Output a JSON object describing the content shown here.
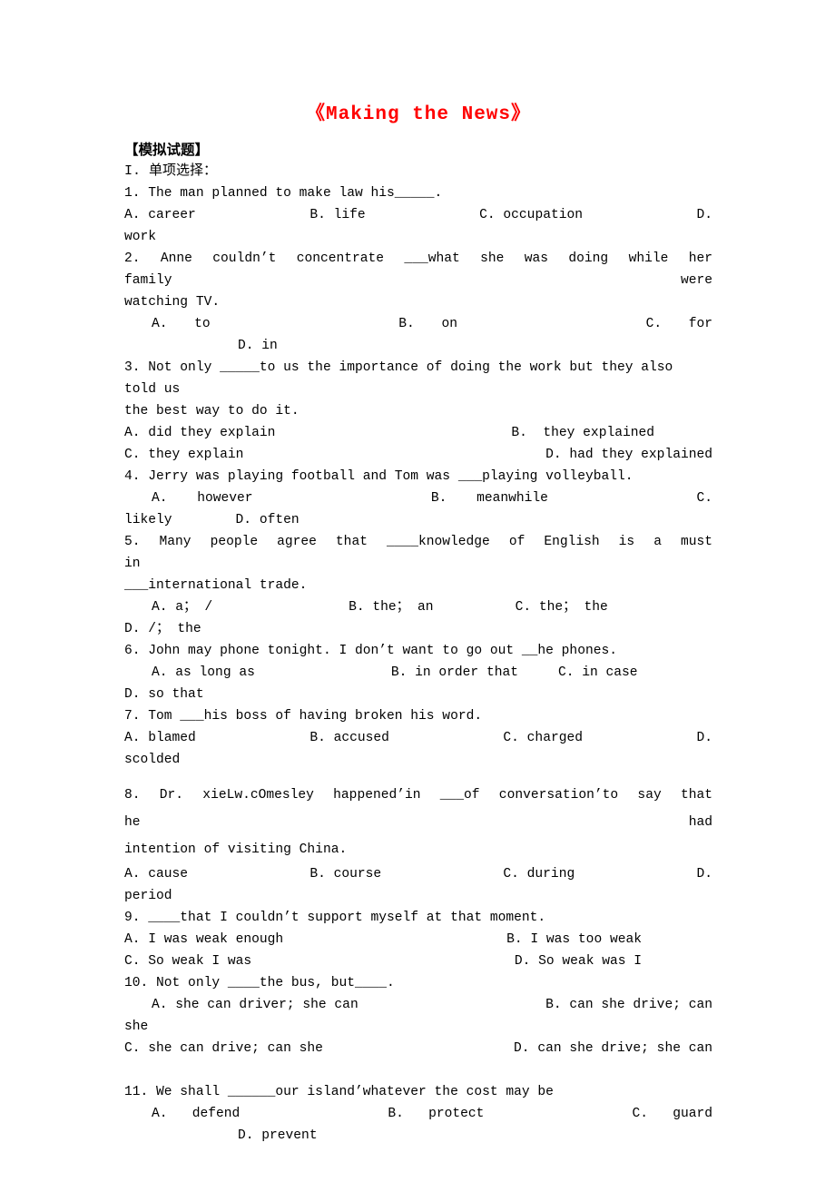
{
  "document": {
    "title": "《Making the News》",
    "section_header": "【模拟试题】",
    "section_subtitle": "I. 单项选择："
  },
  "questions": [
    {
      "id": "q1",
      "stem": "1. The man planned to make law his_____.",
      "options_line1": [
        "A. career",
        "B. life",
        "C. occupation",
        "D."
      ],
      "options_line2": "work"
    },
    {
      "id": "q2",
      "stem_line1": "2.  Anne  couldn’t  concentrate  ___what  she  was  doing  while  her  family  were",
      "stem_line2": "watching TV.",
      "options_line1": [
        "A.",
        "to",
        "B.",
        "on",
        "C.",
        "for"
      ],
      "options_line2": "D. in"
    },
    {
      "id": "q3",
      "stem_line1": "3. Not only _____to us the importance of doing the work but they also told us",
      "stem_line2": "the best way to do it.",
      "option_a": "A. did they explain",
      "option_b": "B.  they explained",
      "option_c": "C. they explain",
      "option_d": "D. had they explained"
    },
    {
      "id": "q4",
      "stem": "4. Jerry was playing football and Tom was ___playing volleyball.",
      "options_line1": [
        "A.",
        "however",
        "B.",
        "meanwhile",
        "C."
      ],
      "options_line2_a": "likely",
      "options_line2_b": "D. often"
    },
    {
      "id": "q5",
      "stem_line1": "5.  Many  people  agree  that  ____knowledge  of  English  is  a  must  in",
      "stem_line2": "___international trade.",
      "options_line1": [
        "A. a； /",
        "B. the； an",
        "C. the； the"
      ],
      "options_line2": "D. /； the"
    },
    {
      "id": "q6",
      "stem": "6. John may phone tonight. I don’t want to go out __he phones.",
      "options_line1": [
        "A. as long as",
        "B. in order that",
        "C. in case"
      ],
      "options_line2": "D. so that"
    },
    {
      "id": "q7",
      "stem": "7. Tom ___his boss of having broken his word.",
      "options_line1": [
        "A. blamed",
        "B. accused",
        "C. charged",
        "D."
      ],
      "options_line2": "scolded"
    },
    {
      "id": "q8",
      "stem_line1": "8.  Dr.  xieLw.cOmesley  happened’in  ___of  conversation’to  say  that  he  had",
      "stem_line2": "intention of visiting China.",
      "options_line1": [
        "A. cause",
        "B. course",
        "C. during",
        "D."
      ],
      "options_line2": "period"
    },
    {
      "id": "q9",
      "stem": "9. ____that I couldn’t support myself at that moment.",
      "option_a": "A. I was weak enough",
      "option_b": "B. I was too weak",
      "option_c": "C. So weak I was",
      "option_d": "D. So weak was I"
    },
    {
      "id": "q10",
      "stem": "10. Not only ____the bus, but____.",
      "option_a": "A. she can driver; she can",
      "option_b": "B. can she drive; can",
      "option_b_wrap": "she",
      "option_c": "C. she can drive; can she",
      "option_d": "D. can she drive; she can"
    },
    {
      "id": "q11",
      "stem": "11. We shall ______our island’whatever the cost may be",
      "options_line1": [
        "A.",
        "defend",
        "B.",
        "protect",
        "C.",
        "guard"
      ],
      "options_line2": "D. prevent"
    }
  ]
}
